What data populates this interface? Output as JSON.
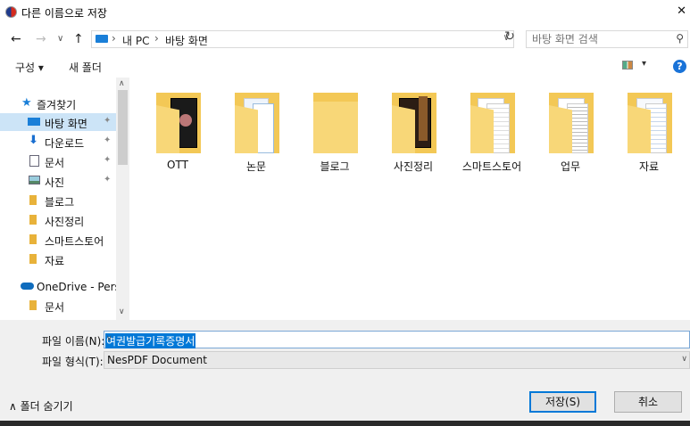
{
  "window": {
    "title": "다른 이름으로 저장",
    "close": "✕"
  },
  "nav": {
    "back": "←",
    "forward": "→",
    "recent": "∨",
    "up": "↑"
  },
  "address": {
    "crumbs": [
      "내 PC",
      "바탕 화면"
    ],
    "sep": "›",
    "dropdown": "∨",
    "refresh": "↻"
  },
  "search": {
    "placeholder": "바탕 화면 검색",
    "icon": "⚲"
  },
  "toolbar": {
    "organize": "구성 ▾",
    "new_folder": "새 폴더",
    "view_dd": "▾",
    "help": "?"
  },
  "sidebar": {
    "items": [
      {
        "label": "즐겨찾기",
        "icon": "star"
      },
      {
        "label": "바탕 화면",
        "icon": "desktop",
        "pinned": true,
        "selected": true
      },
      {
        "label": "다운로드",
        "icon": "download",
        "pinned": true
      },
      {
        "label": "문서",
        "icon": "document",
        "pinned": true
      },
      {
        "label": "사진",
        "icon": "picture",
        "pinned": true
      },
      {
        "label": "블로그",
        "icon": "folder"
      },
      {
        "label": "사진정리",
        "icon": "folder"
      },
      {
        "label": "스마트스토어",
        "icon": "folder"
      },
      {
        "label": "자료",
        "icon": "folder"
      },
      {
        "label": "OneDrive - Persor",
        "icon": "cloud"
      },
      {
        "label": "문서",
        "icon": "folder"
      }
    ],
    "pin": "✦",
    "scroll_up": "∧",
    "scroll_down": "∨"
  },
  "folders": [
    {
      "label": "OTT"
    },
    {
      "label": "논문"
    },
    {
      "label": "블로그"
    },
    {
      "label": "사진정리"
    },
    {
      "label": "스마트스토어"
    },
    {
      "label": "업무"
    },
    {
      "label": "자료"
    }
  ],
  "form": {
    "filename_label": "파일 이름(N):",
    "filename_value": "여권발급기록증명서",
    "filetype_label": "파일 형식(T):",
    "filetype_value": "NesPDF Document",
    "dd": "∨"
  },
  "footer": {
    "hide_folders": "∧ 폴더 숨기기",
    "save": "저장(S)",
    "cancel": "취소"
  },
  "colors": {
    "accent": "#0078d7",
    "folder": "#f3c856",
    "selection": "#cce4f7"
  }
}
